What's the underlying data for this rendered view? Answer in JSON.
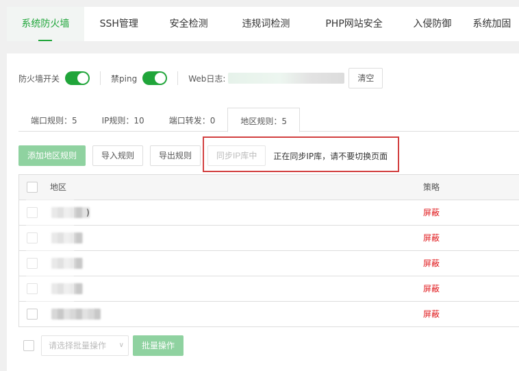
{
  "top_tabs": [
    {
      "label": "系统防火墙",
      "active": true
    },
    {
      "label": "SSH管理"
    },
    {
      "label": "安全检测"
    },
    {
      "label": "违规词检测"
    },
    {
      "label": "PHP网站安全"
    },
    {
      "label": "入侵防御"
    },
    {
      "label": "系统加固"
    }
  ],
  "switches": {
    "firewall_label": "防火墙开关",
    "firewall_on": true,
    "ping_label": "禁ping",
    "ping_on": true,
    "weblog_label": "Web日志:",
    "clear_button": "清空"
  },
  "rule_tabs": [
    {
      "label": "端口规则：5"
    },
    {
      "label": "IP规则：10"
    },
    {
      "label": "端口转发：0"
    },
    {
      "label": "地区规则：5",
      "active": true
    }
  ],
  "toolbar": {
    "add_region_rule": "添加地区规则",
    "import_rule": "导入规则",
    "export_rule": "导出规则",
    "sync_ip": "同步IP库中",
    "sync_status": "正在同步IP库，请不要切换页面"
  },
  "table": {
    "headers": {
      "region": "地区",
      "policy": "策略"
    },
    "rows": [
      {
        "region_suffix": ")",
        "policy": "屏蔽"
      },
      {
        "region_suffix": "",
        "policy": "屏蔽"
      },
      {
        "region_suffix": "",
        "policy": "屏蔽"
      },
      {
        "region_suffix": "",
        "policy": "屏蔽"
      },
      {
        "region_suffix": "",
        "policy": "屏蔽"
      }
    ]
  },
  "batch": {
    "select_placeholder": "请选择批量操作",
    "batch_button": "批量操作"
  },
  "colors": {
    "accent": "#20a53a",
    "danger": "#e0191c",
    "highlight": "#d23f3f"
  }
}
